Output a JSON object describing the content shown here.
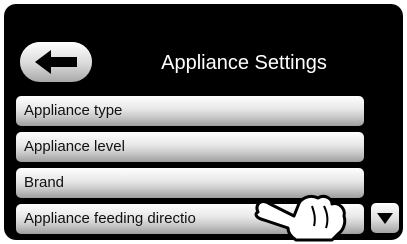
{
  "header": {
    "title": "Appliance Settings",
    "back_icon": "arrow-left-icon"
  },
  "menu": {
    "items": [
      {
        "label": "Appliance type"
      },
      {
        "label": "Appliance level"
      },
      {
        "label": "Brand"
      },
      {
        "label": "Appliance feeding directio"
      }
    ],
    "scroll_down_icon": "triangle-down-icon"
  },
  "overlay": {
    "pointer_icon": "pointing-hand-icon"
  },
  "colors": {
    "screen_background": "#000000",
    "button_light": "#ffffff",
    "button_dark": "#a3a3a3",
    "text": "#111111",
    "title_text": "#ffffff"
  }
}
